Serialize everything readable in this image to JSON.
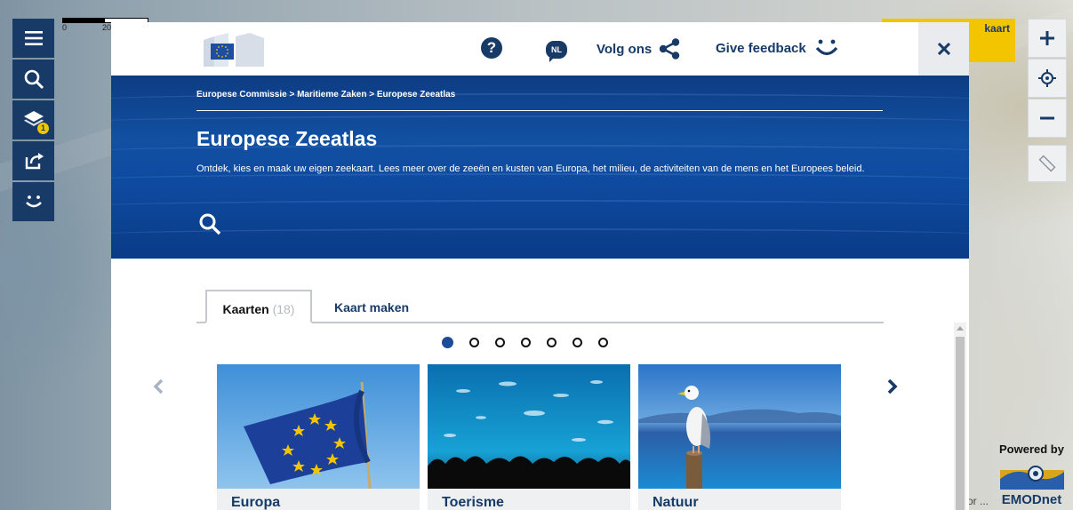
{
  "map": {
    "scale_labels": [
      "0",
      "20"
    ],
    "right_button_label": "kaart",
    "powered_by": "Powered by",
    "emodnet": "EMODnet",
    "attribution": "or ...",
    "layers_badge": "1"
  },
  "header": {
    "language": "NL",
    "follow_label": "Volg ons",
    "feedback_label": "Give feedback"
  },
  "hero": {
    "breadcrumb": "Europese Commissie > Maritieme Zaken > Europese Zeeatlas",
    "title": "Europese Zeeatlas",
    "description": "Ontdek, kies en maak uw eigen zeekaart. Lees meer over de zeeën en kusten van Europa, het milieu, de activiteiten van de mens en het Europees beleid."
  },
  "tabs": {
    "maps_label": "Kaarten",
    "maps_count": "(18)",
    "make_label": "Kaart maken"
  },
  "carousel": {
    "pages": 7,
    "current_page": 1,
    "cards": [
      {
        "label": "Europa"
      },
      {
        "label": "Toerisme"
      },
      {
        "label": "Natuur"
      }
    ]
  },
  "colors": {
    "brand_dark": "#173a66",
    "accent_yellow": "#f2c500",
    "hero_blue": "#0e4aa0"
  }
}
